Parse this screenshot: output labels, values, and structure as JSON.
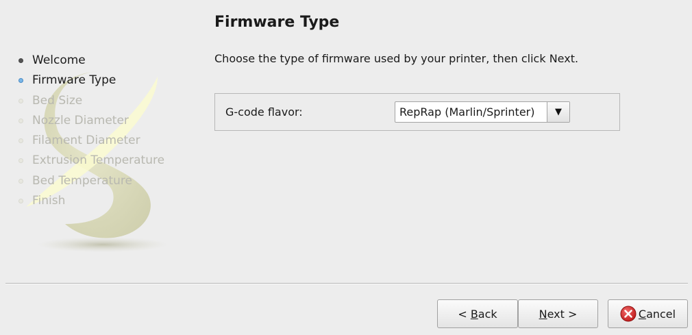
{
  "page": {
    "title": "Firmware Type",
    "instructions": "Choose the type of firmware used by your printer, then click Next."
  },
  "steps": [
    {
      "label": "Welcome",
      "state": "done"
    },
    {
      "label": "Firmware Type",
      "state": "current"
    },
    {
      "label": "Bed Size",
      "state": "todo"
    },
    {
      "label": "Nozzle Diameter",
      "state": "todo"
    },
    {
      "label": "Filament Diameter",
      "state": "todo"
    },
    {
      "label": "Extrusion Temperature",
      "state": "todo"
    },
    {
      "label": "Bed Temperature",
      "state": "todo"
    },
    {
      "label": "Finish",
      "state": "todo"
    }
  ],
  "form": {
    "gcode_label": "G-code flavor:",
    "gcode_value": "RepRap (Marlin/Sprinter)"
  },
  "buttons": {
    "back_prefix": "< ",
    "back_mnemonic": "B",
    "back_rest": "ack",
    "next_mnemonic": "N",
    "next_rest": "ext >",
    "cancel_mnemonic": "C",
    "cancel_rest": "ancel"
  },
  "icons": {
    "combo_arrow": "triangle-down",
    "cancel": "cancel-red-circle-x",
    "logo": "slic3r-logo"
  },
  "colors": {
    "background": "#ededed",
    "current_step_bullet": "#7ab7e8",
    "pending_step_text": "#b8b8b0",
    "cancel_icon": "#d62b2b",
    "logo": "#dcdcb8"
  }
}
